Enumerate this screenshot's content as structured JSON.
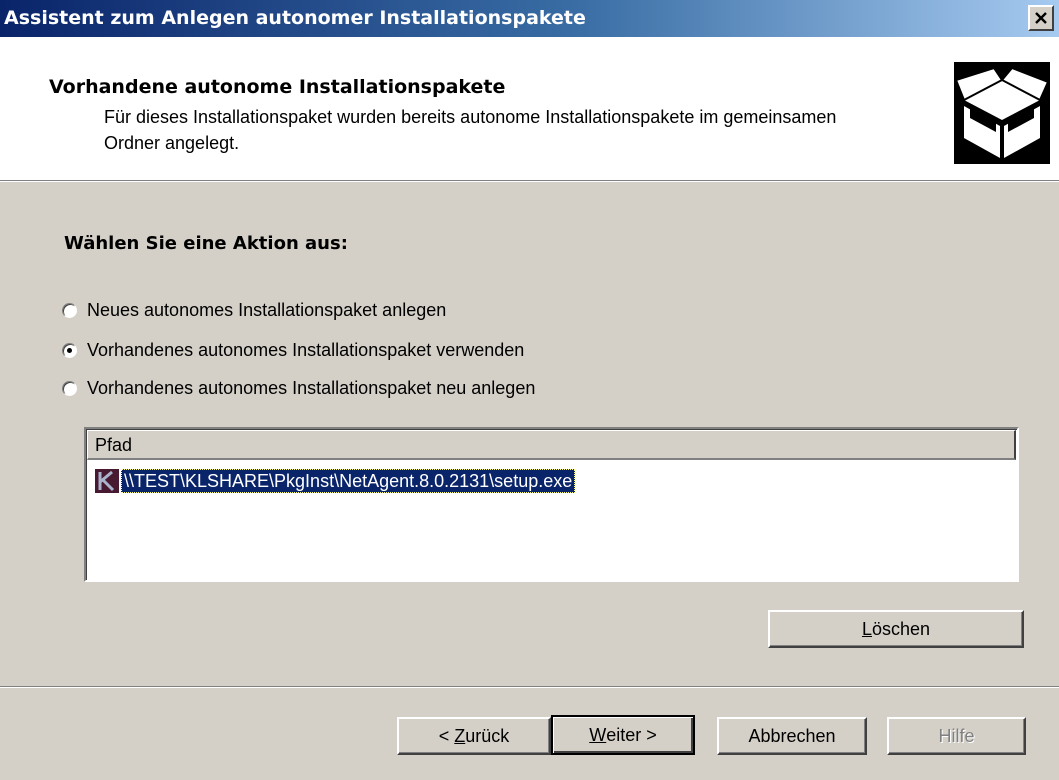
{
  "window": {
    "title": "Assistent zum Anlegen autonomer Installationspakete",
    "close_label": "×"
  },
  "header": {
    "title": "Vorhandene autonome Installationspakete",
    "subtitle": "Für dieses Installationspaket wurden bereits autonome Installationspakete im gemeinsamen Ordner angelegt.",
    "icon": "open-box-icon"
  },
  "main": {
    "heading": "Wählen Sie eine Aktion aus:",
    "options": [
      {
        "label": "Neues autonomes Installationspaket anlegen",
        "checked": false
      },
      {
        "label": "Vorhandenes autonomes Installationspaket verwenden",
        "checked": true
      },
      {
        "label": "Vorhandenes autonomes Installationspaket neu anlegen",
        "checked": false
      }
    ],
    "list": {
      "column": "Pfad",
      "rows": [
        {
          "path": "\\\\TEST\\KLSHARE\\PkgInst\\NetAgent.8.0.2131\\setup.exe",
          "icon": "kaspersky-k-icon",
          "selected": true
        }
      ]
    },
    "delete_button": {
      "mnemonic": "L",
      "rest": "öschen"
    }
  },
  "footer": {
    "back_button": {
      "prefix": "< ",
      "mnemonic": "Z",
      "rest": "urück"
    },
    "next_button": {
      "mnemonic": "W",
      "rest": "eiter >"
    },
    "cancel_button": "Abbrechen",
    "help_button": "Hilfe"
  },
  "colors": {
    "titlebar_start": "#0a246a",
    "titlebar_end": "#a6caf0",
    "face": "#d4d0c8",
    "selection": "#0a246a"
  }
}
